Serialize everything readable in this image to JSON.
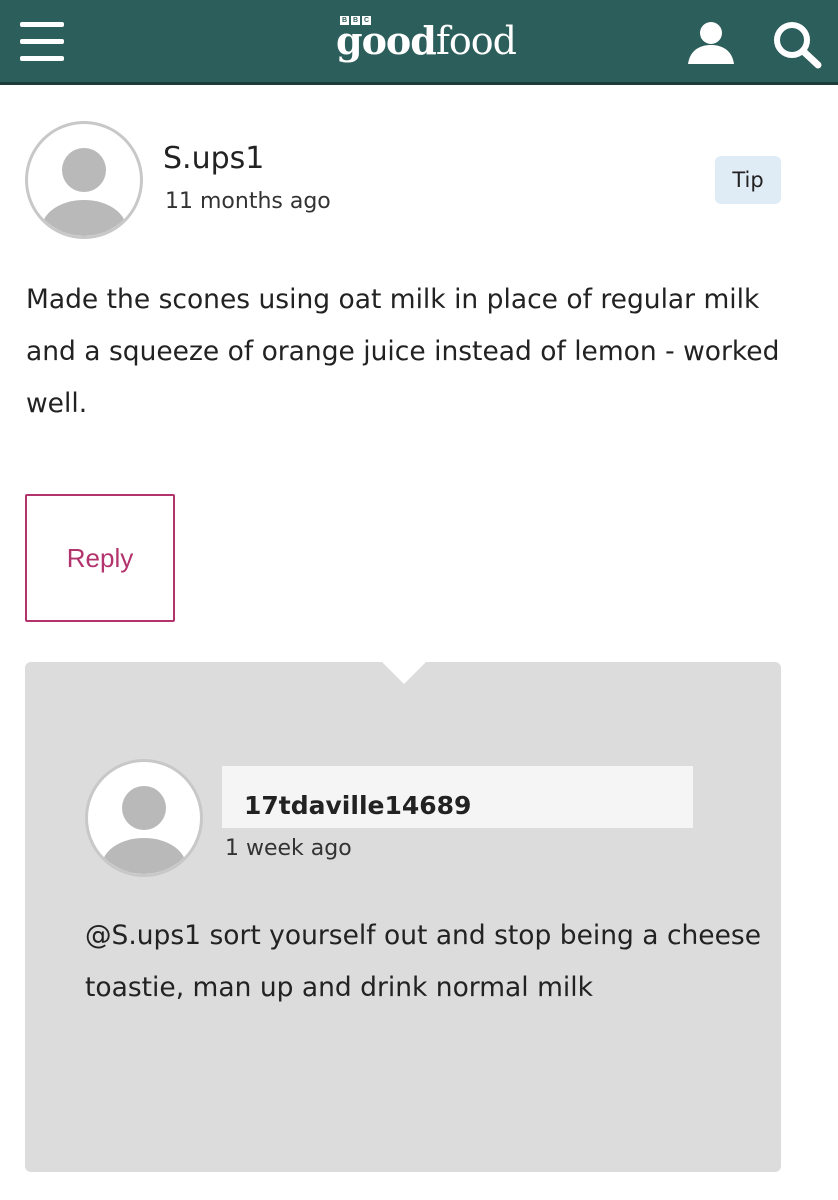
{
  "header": {
    "brand": {
      "bbc": [
        "B",
        "B",
        "C"
      ],
      "good": "good",
      "food": "food"
    },
    "menu_icon": "hamburger-menu-icon",
    "user_icon": "user-icon",
    "search_icon": "search-icon",
    "background_color": "#2c5e5b"
  },
  "comment": {
    "username": "S.ups1",
    "time": "11 months ago",
    "badge": "Tip",
    "body": "Made the scones using oat milk in place of regular milk and a squeeze of orange juice instead of lemon - worked well.",
    "reply_label": "Reply",
    "avatar_icon": "default-avatar-icon"
  },
  "reply": {
    "username": "17tdaville14689",
    "time": "1 week ago",
    "body": "@S.ups1 sort yourself out and stop being a cheese toastie, man up and drink normal milk",
    "avatar_icon": "default-avatar-icon"
  },
  "colors": {
    "accent": "#b3336d",
    "tip_badge": "#dfebf5",
    "reply_panel": "#dcdcdc"
  }
}
